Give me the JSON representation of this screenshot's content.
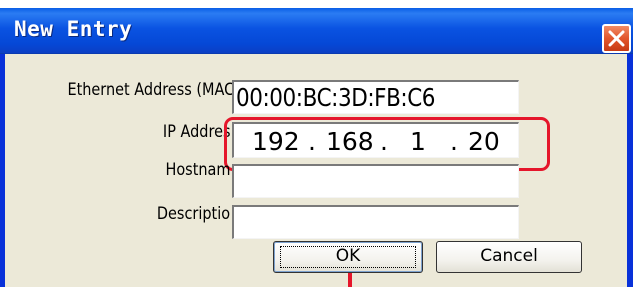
{
  "window": {
    "title": "New Entry",
    "close_icon": "close-icon"
  },
  "form": {
    "mac_label": "Ethernet Address (MAC",
    "mac_value": "00:00:BC:3D:FB:C6",
    "ip_label": "IP Addres",
    "ip_octets": [
      "192",
      "168",
      "1",
      "20"
    ],
    "ip_dots": [
      ".",
      ".",
      "."
    ],
    "hostname_label": "Hostnam",
    "hostname_value": "",
    "description_label": "Descriptio",
    "description_value": ""
  },
  "buttons": {
    "ok_label": "OK",
    "cancel_label": "Cancel"
  },
  "colors": {
    "title_bar": "#0A53E2",
    "dialog_bg": "#ECE9D8",
    "highlight": "#E5162B",
    "close_button": "#E2562C"
  }
}
